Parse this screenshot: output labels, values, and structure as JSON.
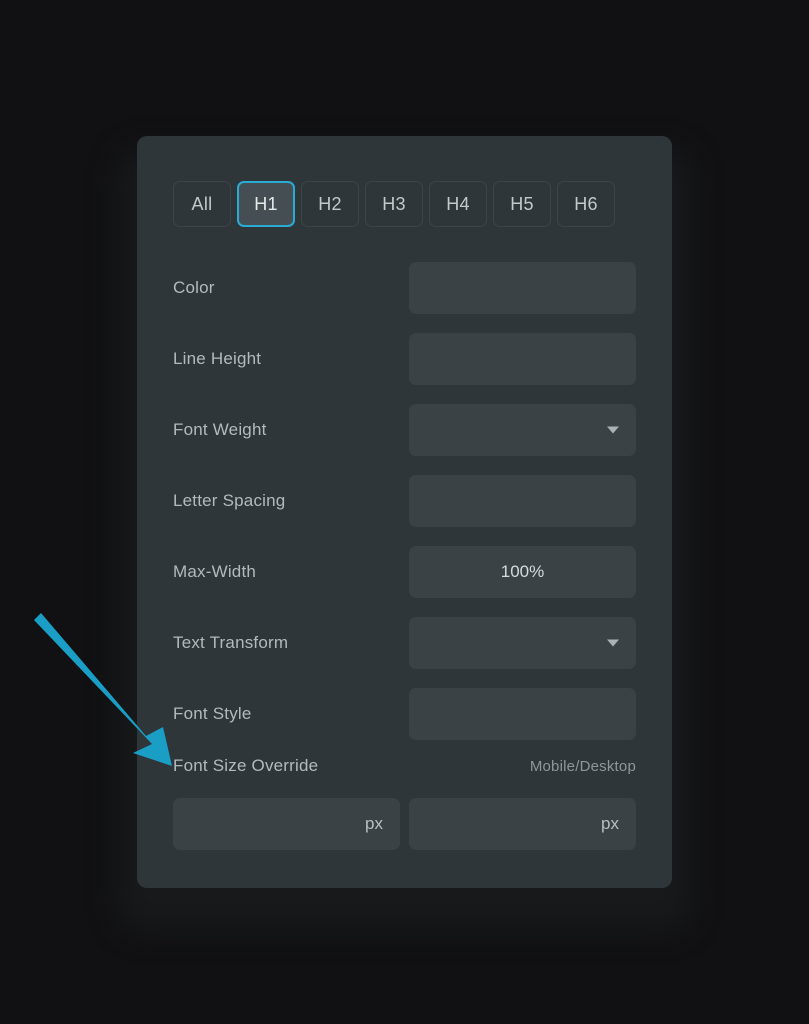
{
  "page": {
    "background_color": "#111113"
  },
  "panel": {
    "background_color": "#2e3639",
    "field_color": "#3b4246"
  },
  "heading_tabs": {
    "active": "H1",
    "accent_color": "#2aabd4",
    "items": [
      {
        "label": "All",
        "active": false
      },
      {
        "label": "H1",
        "active": true
      },
      {
        "label": "H2",
        "active": false
      },
      {
        "label": "H3",
        "active": false
      },
      {
        "label": "H4",
        "active": false
      },
      {
        "label": "H5",
        "active": false
      },
      {
        "label": "H6",
        "active": false
      }
    ]
  },
  "properties": [
    {
      "label": "Color",
      "value": "",
      "control": "text"
    },
    {
      "label": "Line Height",
      "value": "",
      "control": "text"
    },
    {
      "label": "Font Weight",
      "value": "",
      "control": "select"
    },
    {
      "label": "Letter Spacing",
      "value": "",
      "control": "text"
    },
    {
      "label": "Max-Width",
      "value": "100%",
      "control": "text"
    },
    {
      "label": "Text Transform",
      "value": "",
      "control": "select"
    },
    {
      "label": "Font Style",
      "value": "",
      "control": "text"
    }
  ],
  "font_size_override": {
    "label": "Font Size Override",
    "breakpoint_label": "Mobile/Desktop",
    "mobile": {
      "value": "",
      "unit": "px",
      "placeholder": ""
    },
    "desktop": {
      "value": "",
      "unit": "px",
      "placeholder": ""
    }
  },
  "annotation": {
    "arrow_color": "#1b9ec6",
    "points_at": "Font Size Override"
  }
}
